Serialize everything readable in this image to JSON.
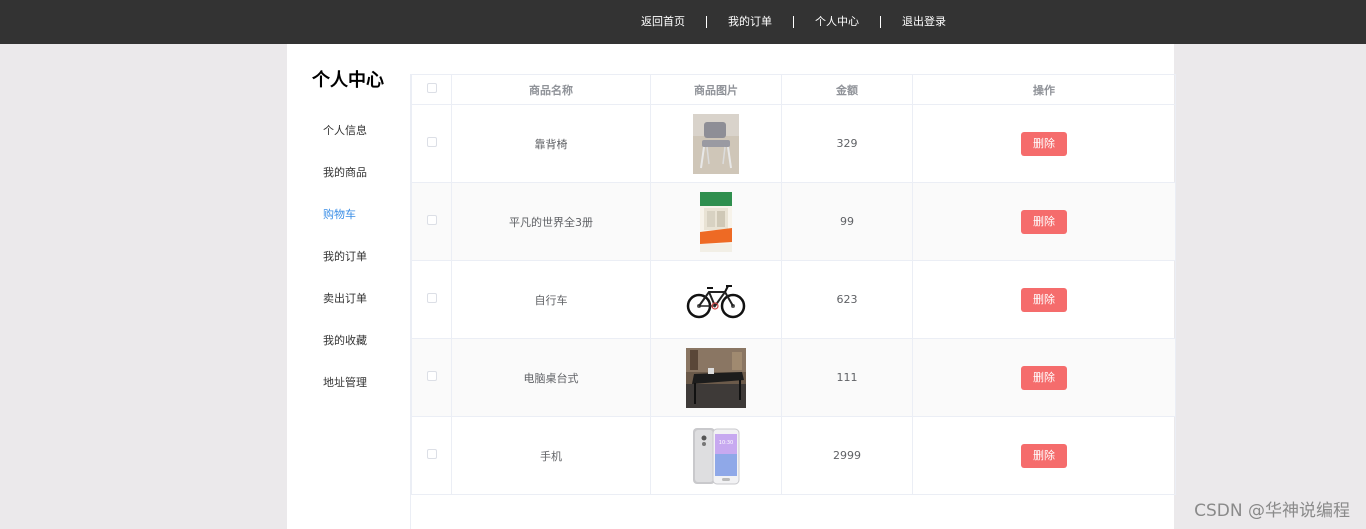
{
  "topnav": {
    "home": "返回首页",
    "orders": "我的订单",
    "profile": "个人中心",
    "logout": "退出登录"
  },
  "sidebar": {
    "title": "个人中心",
    "items": [
      {
        "label": "个人信息"
      },
      {
        "label": "我的商品"
      },
      {
        "label": "购物车"
      },
      {
        "label": "我的订单"
      },
      {
        "label": "卖出订单"
      },
      {
        "label": "我的收藏"
      },
      {
        "label": "地址管理"
      }
    ],
    "active_index": 2
  },
  "table": {
    "headers": {
      "name": "商品名称",
      "image": "商品图片",
      "price": "金额",
      "action": "操作"
    },
    "rows": [
      {
        "name": "靠背椅",
        "price": "329",
        "image_icon": "chair-image",
        "action": "删除"
      },
      {
        "name": "平凡的世界全3册",
        "price": "99",
        "image_icon": "book-image",
        "action": "删除"
      },
      {
        "name": "自行车",
        "price": "623",
        "image_icon": "bicycle-image",
        "action": "删除"
      },
      {
        "name": "电脑桌台式",
        "price": "111",
        "image_icon": "desk-image",
        "action": "删除"
      },
      {
        "name": "手机",
        "price": "2999",
        "image_icon": "phone-image",
        "action": "删除"
      }
    ]
  },
  "watermark": "CSDN @华神说编程",
  "colors": {
    "topbar": "#333333",
    "active_menu": "#3a8ee6",
    "delete_button": "#f56c6c"
  }
}
